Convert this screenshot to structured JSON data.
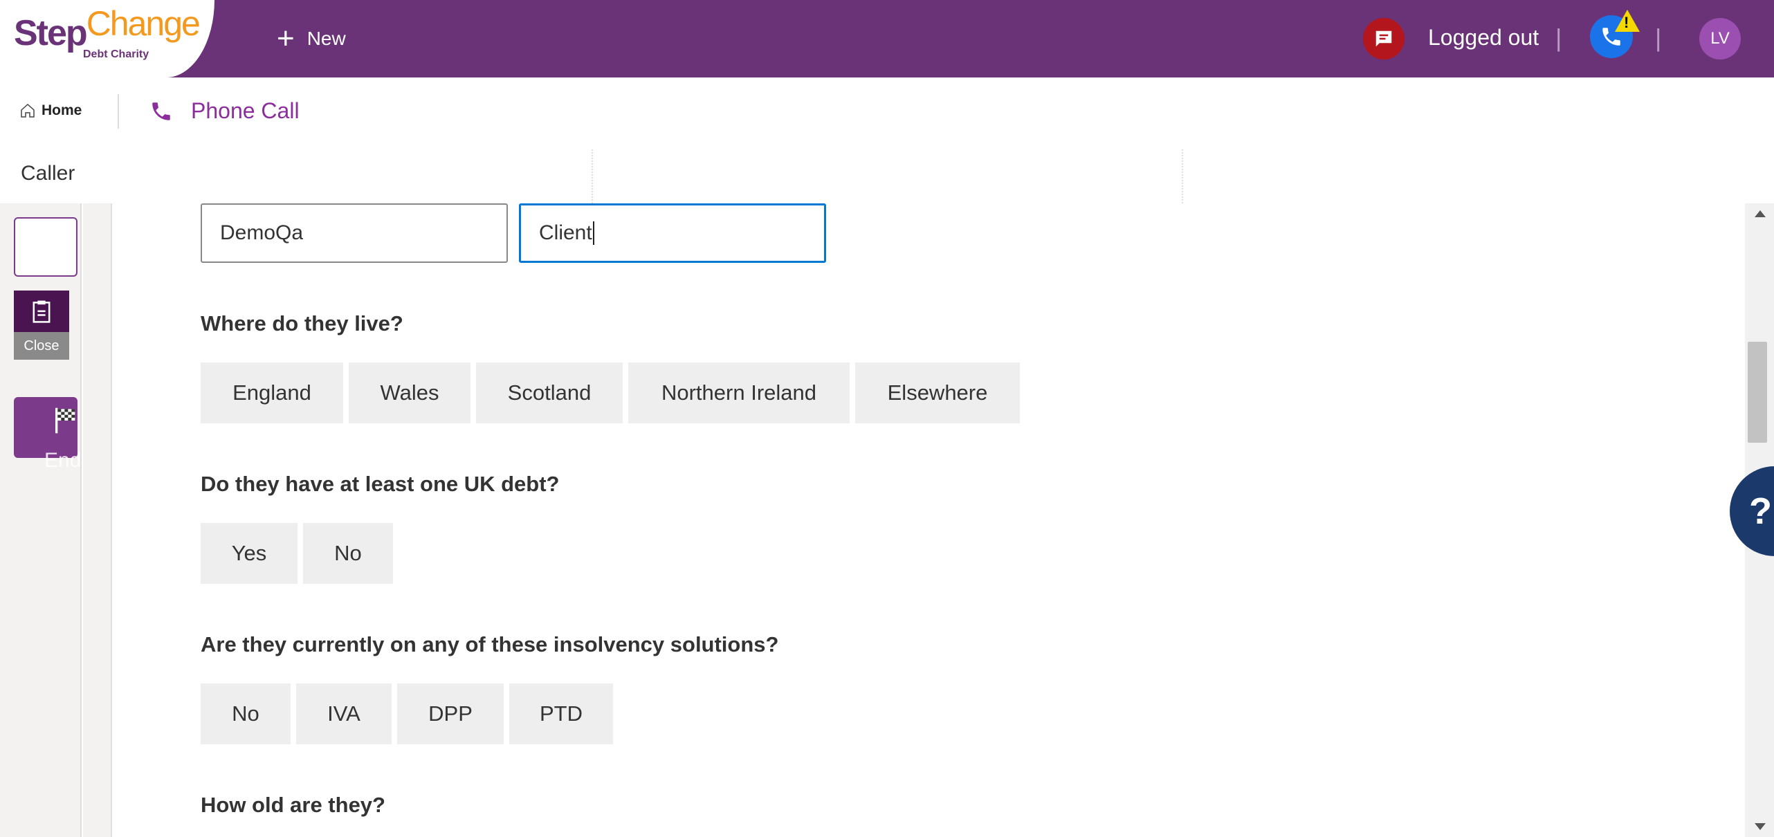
{
  "brand": {
    "logo_step": "Step",
    "logo_change": "Change",
    "logo_charity": "Debt Charity",
    "purple": "#6b3377",
    "orange": "#f39a1e"
  },
  "topbar": {
    "new_label": "New",
    "status_label": "Logged out",
    "separator": "|",
    "avatar_initials": "LV"
  },
  "navbar": {
    "home_label": "Home",
    "tab_label": "Phone Call"
  },
  "header": {
    "caller_label": "Caller"
  },
  "rail": {
    "close_label": "Close",
    "end_session_label": "End Session"
  },
  "form": {
    "first_name": "DemoQa",
    "last_name": "Client",
    "questions": [
      {
        "label": "Where do they live?",
        "options": [
          "England",
          "Wales",
          "Scotland",
          "Northern Ireland",
          "Elsewhere"
        ]
      },
      {
        "label": "Do they have at least one UK debt?",
        "options": [
          "Yes",
          "No"
        ]
      },
      {
        "label": "Are they currently on any of these insolvency solutions?",
        "options": [
          "No",
          "IVA",
          "DPP",
          "PTD"
        ]
      },
      {
        "label": "How old are they?",
        "options": []
      }
    ]
  },
  "help": {
    "label": "?"
  }
}
